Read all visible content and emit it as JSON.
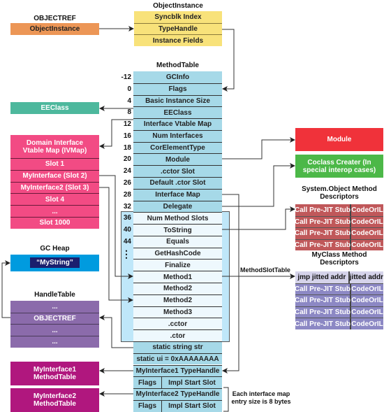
{
  "colors": {
    "objectref": "#ec9656",
    "objectinstance": "#f8e27a",
    "methodtable": "#a6d9e8",
    "methodslots_bg": "#bfe7f9",
    "methodslots_row": "#eef8fd",
    "eeclass": "#4db89d",
    "ivmap": "#f24b84",
    "gcheap": "#009bdf",
    "gcheap_string": "#1b1f6e",
    "handletable": "#8b6bab",
    "interface_mt": "#b0177e",
    "module": "#f0323a",
    "coclass": "#4cb848",
    "sysobj_desc": "#c0585a",
    "myclass_desc": "#8c88c4",
    "myclass_desc_first": "#d5d3ea"
  },
  "objectref": {
    "title": "OBJECTREF",
    "value": "ObjectInstance"
  },
  "objectinstance": {
    "title": "ObjectInstance",
    "rows": [
      "Syncblk Index",
      "TypeHandle",
      "Instance Fields"
    ]
  },
  "methodtable": {
    "title": "MethodTable",
    "rows": [
      {
        "offset": "-12",
        "label": "GCInfo"
      },
      {
        "offset": "0",
        "label": "Flags"
      },
      {
        "offset": "4",
        "label": "Basic Instance Size"
      },
      {
        "offset": "8",
        "label": "EEClass"
      },
      {
        "offset": "12",
        "label": "Interface Vtable Map"
      },
      {
        "offset": "16",
        "label": "Num Interfaces"
      },
      {
        "offset": "18",
        "label": "CorElementType"
      },
      {
        "offset": "20",
        "label": "Module"
      },
      {
        "offset": "24",
        "label": ".cctor Slot"
      },
      {
        "offset": "26",
        "label": "Default .ctor Slot"
      },
      {
        "offset": "28",
        "label": "Interface Map"
      },
      {
        "offset": "32",
        "label": "Delegate"
      },
      {
        "offset": "36",
        "label": "Num Method Slots"
      },
      {
        "offset": "40",
        "label": "ToString"
      },
      {
        "offset": "44",
        "label": "Equals"
      },
      {
        "offset": "",
        "label": "GetHashCode"
      },
      {
        "offset": "",
        "label": "Finalize"
      },
      {
        "offset": "",
        "label": "Method1"
      },
      {
        "offset": "",
        "label": "Method2"
      },
      {
        "offset": "",
        "label": "Method2"
      },
      {
        "offset": "",
        "label": "Method3"
      },
      {
        "offset": "",
        "label": ".cctor"
      },
      {
        "offset": "",
        "label": ".ctor"
      },
      {
        "offset": "",
        "label": "static string str"
      },
      {
        "offset": "",
        "label": "static ui = 0xAAAAAAAA"
      },
      {
        "offset": "",
        "label": "MyInterface1 TypeHandle"
      },
      {
        "offset": "",
        "label": "Flags",
        "label2": "Impl Start Slot"
      },
      {
        "offset": "",
        "label": "MyInterface2 TypeHandle"
      },
      {
        "offset": "",
        "label": "Flags",
        "label2": "Impl Start Slot"
      }
    ],
    "ellipsis": "⋮"
  },
  "eeclass": {
    "label": "EEClass"
  },
  "ivmap": {
    "title": "Domain Interface Vtable Map (IVMap)",
    "rows": [
      "Slot 1",
      "MyInterface (Slot 2)",
      "MyInterface2 (Slot 3)",
      "Slot 4",
      "...",
      "Slot 1000"
    ]
  },
  "gcheap": {
    "title": "GC Heap",
    "value": "“MyString”"
  },
  "handletable": {
    "title": "HandleTable",
    "rows": [
      "...",
      "OBJECTREF",
      "...",
      "..."
    ]
  },
  "interfaces": [
    {
      "label": "MyInterface1 MethodTable"
    },
    {
      "label": "MyInterface2 MethodTable"
    }
  ],
  "module": {
    "label": "Module"
  },
  "coclass": {
    "label": "Coclass Creater (In special interop cases)"
  },
  "sysobj": {
    "title": "System.Object Method Descriptors",
    "rows": [
      [
        "Call Pre-JIT Stub",
        "CodeOrIL"
      ],
      [
        "Call Pre-JIT Stub",
        "CodeOrIL"
      ],
      [
        "Call Pre-JIT Stub",
        "CodeOrIL"
      ],
      [
        "Call Pre-JIT Stub",
        "CodeOrIL"
      ]
    ]
  },
  "myclass": {
    "title": "MyClass Method Descriptors",
    "rows": [
      [
        "jmp jitted addr",
        "jitted addr"
      ],
      [
        "Call Pre-JIT Stub",
        "CodeOrIL"
      ],
      [
        "Call Pre-JIT Stub",
        "CodeOrIL"
      ],
      [
        "Call Pre-JIT Stub",
        "CodeOrIL"
      ],
      [
        "Call Pre-JIT Stub",
        "CodeOrIL"
      ]
    ]
  },
  "labels": {
    "methodslottable": "MethodSlotTable",
    "entry_size": "Each interface map entry size is 8 bytes"
  }
}
